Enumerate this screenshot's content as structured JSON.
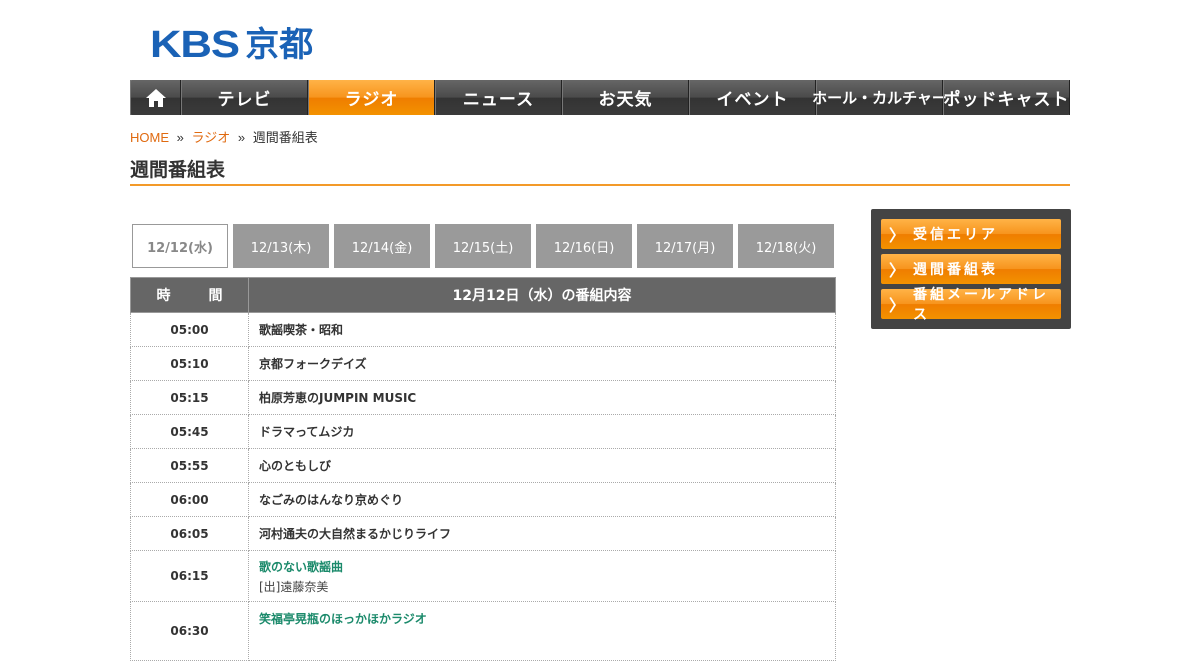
{
  "logo": {
    "latin": "KBS",
    "kanji": "京都"
  },
  "nav": {
    "home_icon": "house-icon",
    "items": [
      "テレビ",
      "ラジオ",
      "ニュース",
      "お天気",
      "イベント",
      "ホール・カルチャー",
      "ポッドキャスト"
    ],
    "active_index": 1
  },
  "breadcrumb": {
    "home": "HOME",
    "sep": "»",
    "radio": "ラジオ",
    "current": "週間番組表"
  },
  "page_title": "週間番組表",
  "days": [
    "12/12(水)",
    "12/13(木)",
    "12/14(金)",
    "12/15(土)",
    "12/16(日)",
    "12/17(月)",
    "12/18(火)"
  ],
  "active_day": 0,
  "table": {
    "col_time": "時　間",
    "col_program": "12月12日（水）の番組内容",
    "rows": [
      {
        "time": "05:00",
        "title": "歌謡喫茶・昭和"
      },
      {
        "time": "05:10",
        "title": "京都フォークデイズ"
      },
      {
        "time": "05:15",
        "title": "柏原芳恵のJUMPIN MUSIC"
      },
      {
        "time": "05:45",
        "title": "ドラマってムジカ"
      },
      {
        "time": "05:55",
        "title": "心のともしび"
      },
      {
        "time": "06:00",
        "title": "なごみのはんなり京めぐり"
      },
      {
        "time": "06:05",
        "title": "河村通夫の大自然まるかじりライフ"
      },
      {
        "time": "06:15",
        "title": "歌のない歌謡曲",
        "cast": "[出]遠藤奈美"
      },
      {
        "time": "06:30",
        "title": "笑福亭晃瓶のほっかほかラジオ"
      }
    ]
  },
  "sidebar": {
    "chevron_icon": "chevron-right-icon",
    "items": [
      "受信エリア",
      "週間番組表",
      "番組メールアドレス"
    ]
  },
  "colors": {
    "accent": "#f39200",
    "logo": "#1a62b6",
    "link_green": "#1b8a6b",
    "header_gray": "#666666"
  }
}
